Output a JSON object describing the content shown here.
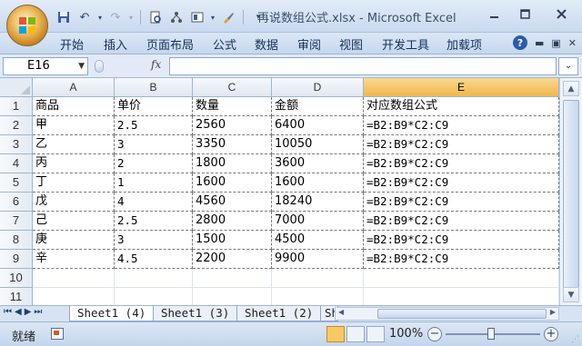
{
  "window": {
    "title": "再说数组公式.xlsx - Microsoft Excel",
    "minimize_icon": "minimize-icon",
    "restore_icon": "restore-icon",
    "close_icon": "close-icon"
  },
  "quick_access": [
    "save-icon",
    "undo-icon",
    "redo-icon",
    "print-preview-icon",
    "tree-icon",
    "layout-icon",
    "brush-icon",
    "customize-dropdown-icon"
  ],
  "ribbon": {
    "tabs": [
      "开始",
      "插入",
      "页面布局",
      "公式",
      "数据",
      "审阅",
      "视图",
      "开发工具",
      "加载项"
    ],
    "help": "?"
  },
  "formula_bar": {
    "name_box": "E16",
    "fx": "fx",
    "formula": ""
  },
  "sheet": {
    "columns": [
      "A",
      "B",
      "C",
      "D",
      "E"
    ],
    "selected_column": "E",
    "rows": [
      "1",
      "2",
      "3",
      "4",
      "5",
      "6",
      "7",
      "8",
      "9",
      "10",
      "11"
    ],
    "cells": [
      [
        "商品",
        "单价",
        "数量",
        "金额",
        "对应数组公式"
      ],
      [
        "甲",
        "2.5",
        "2560",
        "6400",
        "=B2:B9*C2:C9"
      ],
      [
        "乙",
        "3",
        "3350",
        "10050",
        "=B2:B9*C2:C9"
      ],
      [
        "丙",
        "2",
        "1800",
        "3600",
        "=B2:B9*C2:C9"
      ],
      [
        "丁",
        "1",
        "1600",
        "1600",
        "=B2:B9*C2:C9"
      ],
      [
        "戊",
        "4",
        "4560",
        "18240",
        "=B2:B9*C2:C9"
      ],
      [
        "己",
        "2.5",
        "2800",
        "7000",
        "=B2:B9*C2:C9"
      ],
      [
        "庚",
        "3",
        "1500",
        "4500",
        "=B2:B9*C2:C9"
      ],
      [
        "辛",
        "4.5",
        "2200",
        "9900",
        "=B2:B9*C2:C9"
      ]
    ]
  },
  "sheet_tabs": [
    "Sheet1 (4)",
    "Sheet1 (3)",
    "Sheet1 (2)",
    "Sh"
  ],
  "active_sheet": "Sheet1 (4)",
  "status": {
    "ready": "就绪",
    "zoom": "100%"
  },
  "colors": {
    "accent": "#f2b64d",
    "ribbon": "#c6d7ee",
    "frame": "#9fb6d6"
  }
}
